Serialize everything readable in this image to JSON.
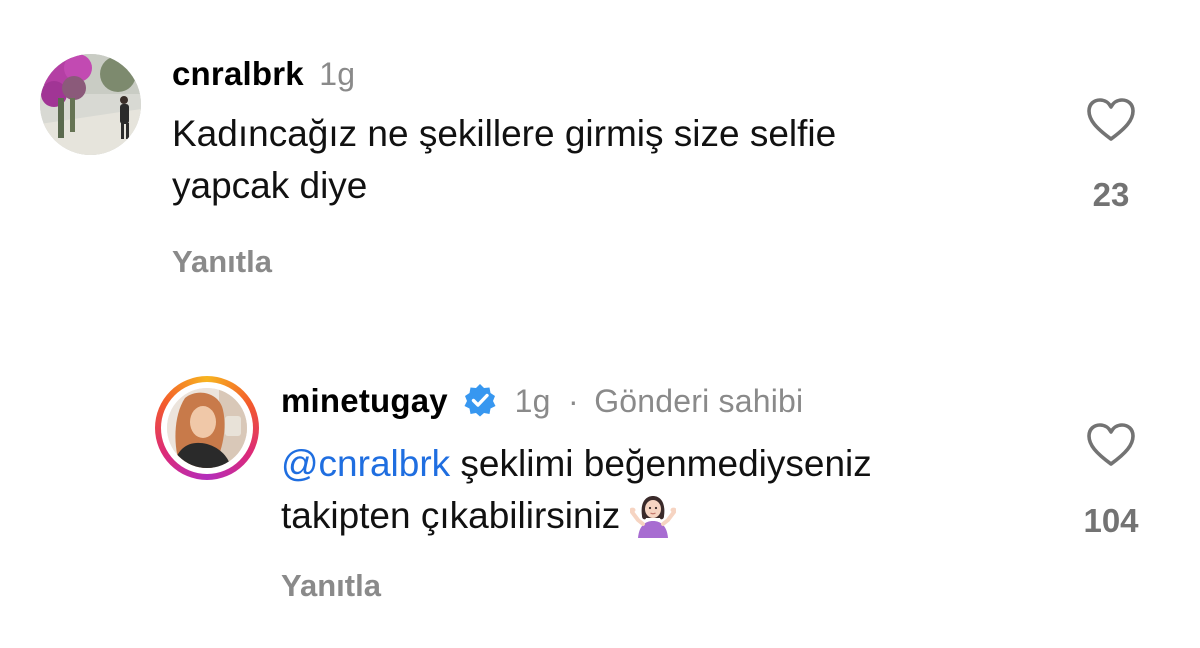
{
  "comments": [
    {
      "username": "cnralbrk",
      "time": "1g",
      "text_line1": "Kadıncağız ne şekillere girmiş size selfie",
      "text_line2": "yapcak diye",
      "reply_label": "Yanıtla",
      "like_count": "23",
      "avatar": "profile-photo"
    },
    {
      "username": "minetugay",
      "verified": true,
      "time": "1g",
      "separator": "·",
      "author_label": "Gönderi sahibi",
      "mention": "@cnralbrk",
      "text_line1": " şeklimi beğenmediyseniz",
      "text_line2": "takipten çıkabilirsiniz",
      "emoji": "woman-shrugging-emoji",
      "reply_label": "Yanıtla",
      "like_count": "104",
      "avatar": "profile-photo-with-story-ring"
    }
  ],
  "colors": {
    "mention": "#1f6ee0",
    "muted": "#8a8a8a",
    "verified": "#3797f0",
    "story_ring": [
      "#f7b41f",
      "#f35b2b",
      "#dc2a78",
      "#b42dbb"
    ]
  },
  "icons": {
    "like": "heart-outline-icon",
    "verified": "verified-badge-icon"
  }
}
